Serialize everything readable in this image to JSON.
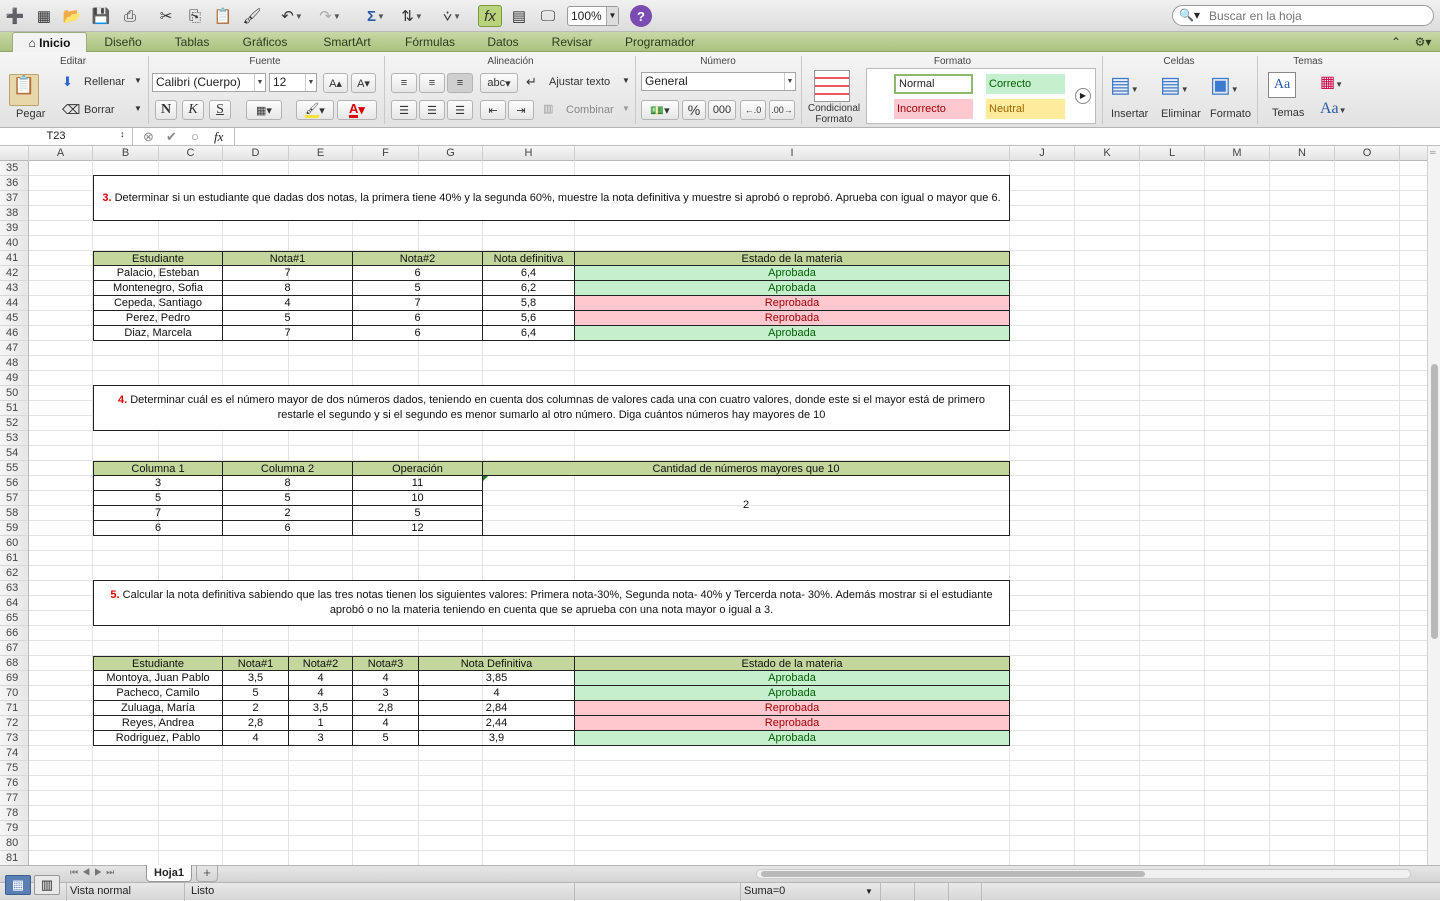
{
  "toolbar": {
    "zoom": "100%",
    "search_placeholder": "Buscar en la hoja"
  },
  "tabs": [
    "Inicio",
    "Diseño",
    "Tablas",
    "Gráficos",
    "SmartArt",
    "Fórmulas",
    "Datos",
    "Revisar",
    "Programador"
  ],
  "ribbon": {
    "groups": {
      "editar": "Editar",
      "fuente": "Fuente",
      "alineacion": "Alineación",
      "numero": "Número",
      "formato": "Formato",
      "celdas": "Celdas",
      "temas": "Temas"
    },
    "pegar": "Pegar",
    "rellenar": "Rellenar",
    "borrar": "Borrar",
    "font_name": "Calibri (Cuerpo)",
    "font_size": "12",
    "bold": "N",
    "italic": "K",
    "underline": "S",
    "abc": "abc",
    "ajustar": "Ajustar texto",
    "combinar": "Combinar",
    "number_format": "General",
    "percent": "%",
    "thousands": "000",
    "cond_format_1": "Condicional",
    "cond_format_2": "Formato",
    "styles": {
      "normal": "Normal",
      "correcto": "Correcto",
      "incorrecto": "Incorrecto",
      "neutral": "Neutral"
    },
    "insertar": "Insertar",
    "eliminar": "Eliminar",
    "formato": "Formato",
    "temas": "Temas",
    "aa": "Aa"
  },
  "formula_bar": {
    "name_box": "T23",
    "fx": "fx",
    "value": ""
  },
  "columns": [
    "A",
    "B",
    "C",
    "D",
    "E",
    "F",
    "G",
    "H",
    "I",
    "J",
    "K",
    "L",
    "M",
    "N",
    "O"
  ],
  "rows": [
    "35",
    "36",
    "37",
    "38",
    "39",
    "40",
    "41",
    "42",
    "43",
    "44",
    "45",
    "46",
    "47",
    "48",
    "49",
    "50",
    "51",
    "52",
    "53",
    "54",
    "55",
    "56",
    "57",
    "58",
    "59",
    "60",
    "61",
    "62",
    "63",
    "64",
    "65",
    "66",
    "67",
    "68",
    "69",
    "70",
    "71",
    "72",
    "73",
    "74",
    "75",
    "76",
    "77",
    "78",
    "79",
    "80",
    "81"
  ],
  "sec3": {
    "num": "3.",
    "text": " Determinar si un estudiante que dadas dos notas, la primera tiene 40% y la segunda 60%, muestre la nota definitiva y muestre si aprobó o reprobó. Aprueba con igual o mayor que 6.",
    "headers": [
      "Estudiante",
      "Nota#1",
      "Nota#2",
      "Nota definitiva",
      "Estado de la materia"
    ],
    "rows": [
      [
        "Palacio, Esteban",
        "7",
        "6",
        "6,4",
        "Aprobada"
      ],
      [
        "Montenegro, Sofia",
        "8",
        "5",
        "6,2",
        "Aprobada"
      ],
      [
        "Cepeda, Santiago",
        "4",
        "7",
        "5,8",
        "Reprobada"
      ],
      [
        "Perez, Pedro",
        "5",
        "6",
        "5,6",
        "Reprobada"
      ],
      [
        "Diaz, Marcela",
        "7",
        "6",
        "6,4",
        "Aprobada"
      ]
    ]
  },
  "sec4": {
    "num": "4.",
    "text": " Determinar cuál es el número mayor de dos números dados, teniendo en cuenta dos columnas de valores cada una con cuatro valores, donde este si el mayor está de primero restarle el segundo y si el segundo es menor sumarlo al otro número. Diga cuántos números hay mayores de 10",
    "headers": [
      "Columna 1",
      "Columna 2",
      "Operación",
      "Cantidad de números mayores que 10"
    ],
    "rows": [
      [
        "3",
        "8",
        "11"
      ],
      [
        "5",
        "5",
        "10"
      ],
      [
        "7",
        "2",
        "5"
      ],
      [
        "6",
        "6",
        "12"
      ]
    ],
    "count": "2"
  },
  "sec5": {
    "num": "5.",
    "text": " Calcular la nota definitiva sabiendo que las tres notas tienen los siguientes valores: Primera nota-30%, Segunda nota- 40% y Tercerda nota- 30%. Además mostrar si el estudiante aprobó o no la materia teniendo en cuenta que se aprueba con una nota mayor o igual a 3.",
    "headers": [
      "Estudiante",
      "Nota#1",
      "Nota#2",
      "Nota#3",
      "Nota Definitiva",
      "Estado de la materia"
    ],
    "rows": [
      [
        "Montoya, Juan Pablo",
        "3,5",
        "4",
        "4",
        "3,85",
        "Aprobada"
      ],
      [
        "Pacheco, Camilo",
        "5",
        "4",
        "3",
        "4",
        "Aprobada"
      ],
      [
        "Zuluaga, María",
        "2",
        "3,5",
        "2,8",
        "2,84",
        "Reprobada"
      ],
      [
        "Reyes, Andrea",
        "2,8",
        "1",
        "4",
        "2,44",
        "Reprobada"
      ],
      [
        "Rodriguez, Pablo",
        "4",
        "3",
        "5",
        "3,9",
        "Aprobada"
      ]
    ]
  },
  "sheet_tab": "Hoja1",
  "status": {
    "view": "Vista normal",
    "ready": "Listo",
    "sum": "Suma=0"
  },
  "colors": {
    "header_fill": "#c3d69b",
    "approved_fill": "#c6efce",
    "approved_text": "#006100",
    "failed_fill": "#ffc7ce",
    "failed_text": "#9c0006",
    "ribbon_tabs": "#b6cc8c"
  }
}
